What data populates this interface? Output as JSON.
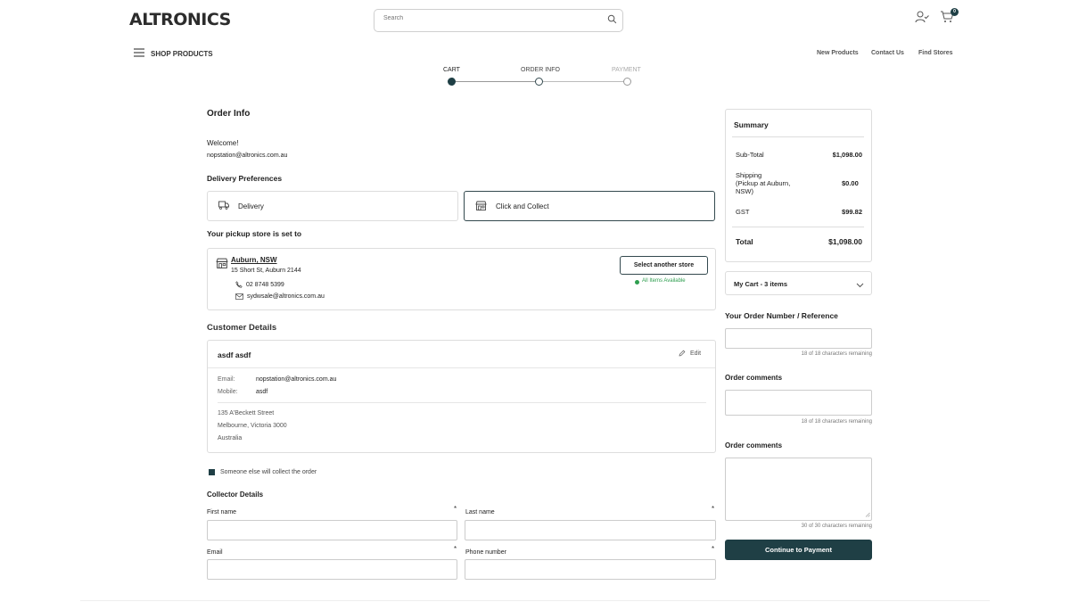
{
  "header": {
    "logo": "ALTRONICS",
    "search_placeholder": "Search",
    "cart_count": "0",
    "shop_products": "SHOP PRODUCTS",
    "nav": [
      "New Products",
      "Contact Us",
      "Find Stores"
    ]
  },
  "steps": [
    "CART",
    "ORDER INFO",
    "PAYMENT"
  ],
  "order_info": {
    "title": "Order Info",
    "welcome": "Welcome!",
    "email": "nopstation@altronics.com.au",
    "delivery_prefs_title": "Delivery Preferences",
    "delivery": "Delivery",
    "click_collect": "Click and Collect",
    "pickup_title": "Your pickup store is set to",
    "store": {
      "name": "Auburn, NSW",
      "address": "15 Short St, Auburn 2144",
      "phone": "02 8748 5399",
      "email": "sydwsale@altronics.com.au",
      "select_button": "Select another store",
      "availability": "All Items Available"
    }
  },
  "customer": {
    "title": "Customer Details",
    "name": "asdf asdf",
    "edit": "Edit",
    "email_label": "Email:",
    "email": "nopstation@altronics.com.au",
    "mobile_label": "Mobile:",
    "mobile": "asdf",
    "address_lines": [
      "135 A'Beckett Street",
      "Melbourne, Victoria 3000",
      "Australia"
    ]
  },
  "collector": {
    "checkbox_label": "Someone else will collect the order",
    "title": "Collector Details",
    "first_name": "First name",
    "last_name": "Last name",
    "email": "Email",
    "phone": "Phone number",
    "required_mark": "*"
  },
  "summary": {
    "title": "Summary",
    "subtotal_label": "Sub-Total",
    "subtotal": "$1,098.00",
    "shipping_label_1": "Shipping",
    "shipping_label_2": "(Pickup at Auburn,",
    "shipping_label_3": "NSW)",
    "shipping": "$0.00",
    "gst_label": "GST",
    "gst": "$99.82",
    "total_label": "Total",
    "total": "$1,098.00"
  },
  "cart": {
    "label": "My Cart - 3 items"
  },
  "sidebar": {
    "order_number_title": "Your Order Number / Reference",
    "order_number_note": "18 of 18 characters remaining",
    "comments1_title": "Order comments",
    "comments1_note": "18 of 18 characters remaining",
    "comments2_title": "Order comments",
    "comments2_note": "30 of 30 characters remaining",
    "continue": "Continue to Payment"
  },
  "colors": {
    "accent": "#1f3f45",
    "available": "#2e9e4f"
  }
}
